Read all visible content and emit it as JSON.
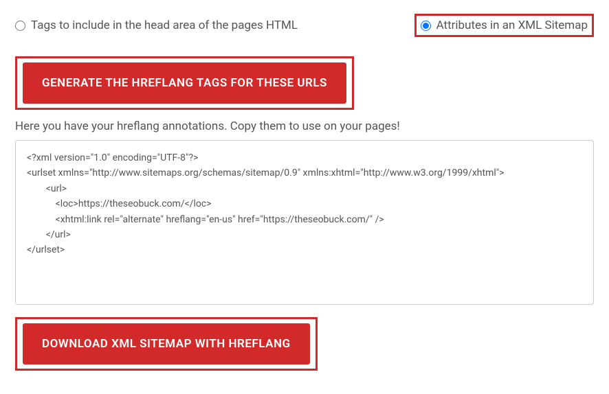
{
  "radios": {
    "option1": {
      "label": "Tags to include in the head area of the pages HTML",
      "checked": false
    },
    "option2": {
      "label": "Attributes in an XML Sitemap",
      "checked": true
    }
  },
  "buttons": {
    "generate": "GENERATE THE HREFLANG TAGS FOR THESE URLS",
    "download": "DOWNLOAD XML SITEMAP WITH HREFLANG"
  },
  "instruction": "Here you have your hreflang annotations. Copy them to use on your pages!",
  "code_output": "<?xml version=\"1.0\" encoding=\"UTF-8\"?>\n<urlset xmlns=\"http://www.sitemaps.org/schemas/sitemap/0.9\" xmlns:xhtml=\"http://www.w3.org/1999/xhtml\">\n        <url>\n            <loc>https://theseobuck.com/</loc>\n            <xhtml:link rel=\"alternate\" hreflang=\"en-us\" href=\"https://theseobuck.com/\" />\n        </url>\n</urlset>"
}
